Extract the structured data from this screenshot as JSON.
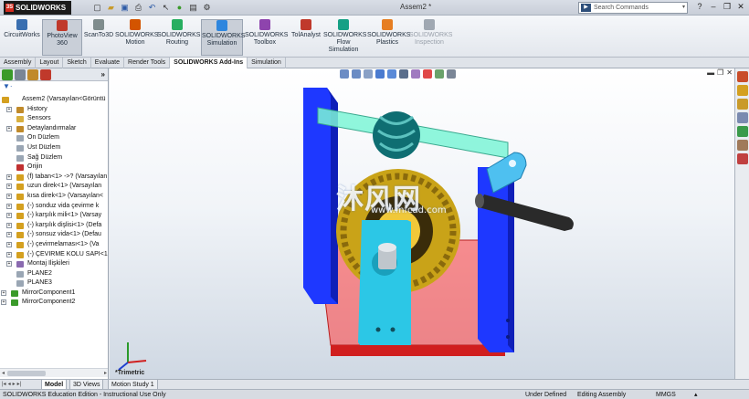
{
  "app": {
    "brand": "SOLIDWORKS",
    "document_title": "Assem2 *"
  },
  "search": {
    "placeholder": "Search Commands"
  },
  "window_controls": [
    "?",
    "–",
    "❐",
    "✕"
  ],
  "command_manager": [
    {
      "label": "CircuitWorks",
      "icon": "circuitworks-icon",
      "color": "#3a6fb0",
      "state": "normal"
    },
    {
      "label": "PhotoView 360",
      "icon": "photoview-icon",
      "color": "#c0392b",
      "state": "active"
    },
    {
      "label": "ScanTo3D",
      "icon": "scanto3d-icon",
      "color": "#7f8c8d",
      "state": "normal"
    },
    {
      "label": "SOLIDWORKS Motion",
      "icon": "motion-icon",
      "color": "#d35400",
      "state": "normal"
    },
    {
      "label": "SOLIDWORKS Routing",
      "icon": "routing-icon",
      "color": "#27ae60",
      "state": "normal"
    },
    {
      "label": "SOLIDWORKS Simulation",
      "icon": "simulation-icon",
      "color": "#2e86de",
      "state": "active"
    },
    {
      "label": "SOLIDWORKS Toolbox",
      "icon": "toolbox-icon",
      "color": "#8e44ad",
      "state": "normal"
    },
    {
      "label": "TolAnalyst",
      "icon": "tolanalyst-icon",
      "color": "#c0392b",
      "state": "normal"
    },
    {
      "label": "SOLIDWORKS Flow Simulation",
      "icon": "flow-simulation-icon",
      "color": "#16a085",
      "state": "normal"
    },
    {
      "label": "SOLIDWORKS Plastics",
      "icon": "plastics-icon",
      "color": "#e67e22",
      "state": "normal"
    },
    {
      "label": "SOLIDWORKS Inspection",
      "icon": "inspection-icon",
      "color": "#a0a8b2",
      "state": "disabled"
    }
  ],
  "tabs": [
    {
      "label": "Assembly",
      "active": false
    },
    {
      "label": "Layout",
      "active": false
    },
    {
      "label": "Sketch",
      "active": false
    },
    {
      "label": "Evaluate",
      "active": false
    },
    {
      "label": "Render Tools",
      "active": false
    },
    {
      "label": "SOLIDWORKS Add-Ins",
      "active": true
    },
    {
      "label": "Simulation",
      "active": false
    }
  ],
  "feature_tree": {
    "root": "Assem2  (Varsayılan<Görüntü",
    "items": [
      {
        "label": "History",
        "expander": "+",
        "icon": "history-icon",
        "indent": 1
      },
      {
        "label": "Sensors",
        "expander": "",
        "icon": "sensors-icon",
        "indent": 1
      },
      {
        "label": "Detaylandırmalar",
        "expander": "+",
        "icon": "annotations-icon",
        "indent": 1
      },
      {
        "label": "Ön Düzlem",
        "expander": "",
        "icon": "plane-icon",
        "indent": 1
      },
      {
        "label": "Üst Düzlem",
        "expander": "",
        "icon": "plane-icon",
        "indent": 1
      },
      {
        "label": "Sağ Düzlem",
        "expander": "",
        "icon": "plane-icon",
        "indent": 1
      },
      {
        "label": "Orijin",
        "expander": "",
        "icon": "origin-icon",
        "indent": 1
      },
      {
        "label": "(f) taban<1> ->? (Varsayılan",
        "expander": "+",
        "icon": "part-icon",
        "indent": 1
      },
      {
        "label": "uzun direk<1> (Varsayılan",
        "expander": "+",
        "icon": "part-icon",
        "indent": 1
      },
      {
        "label": "kısa direk<1> (Varsayılan<",
        "expander": "+",
        "icon": "part-icon",
        "indent": 1
      },
      {
        "label": "(-) sonduz vida çevirme k",
        "expander": "+",
        "icon": "part-icon",
        "indent": 1
      },
      {
        "label": "(-) karşılık mili<1> (Varsay",
        "expander": "+",
        "icon": "part-icon",
        "indent": 1
      },
      {
        "label": "(-) karşılık dişlisi<1> (Defa",
        "expander": "+",
        "icon": "part-icon",
        "indent": 1
      },
      {
        "label": "(-) sonsuz vida<1> (Defau",
        "expander": "+",
        "icon": "part-icon",
        "indent": 1
      },
      {
        "label": "(-) çevirmelaması<1> (Va",
        "expander": "+",
        "icon": "part-icon",
        "indent": 1
      },
      {
        "label": "(-) ÇEVİRME KOLU SAPI<1",
        "expander": "+",
        "icon": "part-icon",
        "indent": 1
      },
      {
        "label": "Montaj İlişkileri",
        "expander": "+",
        "icon": "mates-icon",
        "indent": 1
      },
      {
        "label": "PLANE2",
        "expander": "",
        "icon": "plane-icon",
        "indent": 1
      },
      {
        "label": "PLANE3",
        "expander": "",
        "icon": "plane-icon",
        "indent": 1
      },
      {
        "label": "MirrorComponent1",
        "expander": "+",
        "icon": "mirror-icon",
        "indent": 0
      },
      {
        "label": "MirrorComponent2",
        "expander": "+",
        "icon": "mirror-icon",
        "indent": 0
      }
    ]
  },
  "viewport": {
    "watermark_cn": "沐风网",
    "watermark_url": "www.mfcad.com",
    "view_label": "*Trimetric"
  },
  "bottom_tabs": [
    {
      "label": "Model",
      "active": true
    },
    {
      "label": "3D Views",
      "active": false
    },
    {
      "label": "Motion Study 1",
      "active": false
    }
  ],
  "status": {
    "edition": "SOLIDWORKS Education Edition - Instructional Use Only",
    "definition": "Under Defined",
    "mode": "Editing Assembly",
    "units": "MMGS"
  }
}
